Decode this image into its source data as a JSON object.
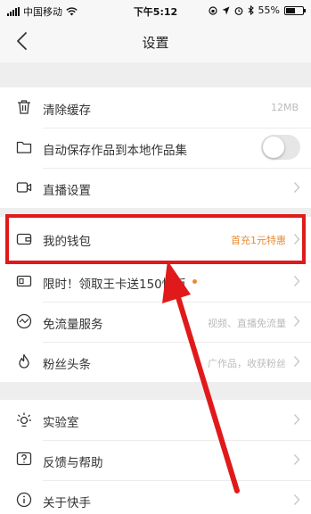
{
  "status_bar": {
    "carrier": "中国移动",
    "time": "下午5:12",
    "battery": "55%"
  },
  "nav": {
    "title": "设置",
    "back_icon": "chevron-left-icon"
  },
  "groups": [
    {
      "items": [
        {
          "label": "清除缓存",
          "icon": "trash-icon",
          "value": "12MB"
        },
        {
          "label": "自动保存作品到本地作品集",
          "icon": "folder-icon",
          "toggle": false
        },
        {
          "label": "直播设置",
          "icon": "camera-icon"
        }
      ]
    },
    {
      "items": [
        {
          "label": "我的钱包",
          "icon": "wallet-icon",
          "value": "首充1元特惠",
          "highlighted": true
        },
        {
          "label": "限时！领取王卡送150快币",
          "icon": "card-icon",
          "badge_dot": true
        },
        {
          "label": "免流量服务",
          "icon": "pulse-icon",
          "value": "视频、直播免流量"
        },
        {
          "label": "粉丝头条",
          "icon": "fire-icon",
          "value": "广作品，收获粉丝"
        }
      ]
    },
    {
      "items": [
        {
          "label": "实验室",
          "icon": "bulb-icon"
        },
        {
          "label": "反馈与帮助",
          "icon": "help-icon"
        },
        {
          "label": "关于快手",
          "icon": "info-icon"
        }
      ]
    }
  ],
  "annotation": {
    "highlight_color": "#e01a1a",
    "arrow_color": "#e01a1a"
  },
  "colors": {
    "promo": "#e98b34",
    "background": "#f2f2f2"
  }
}
